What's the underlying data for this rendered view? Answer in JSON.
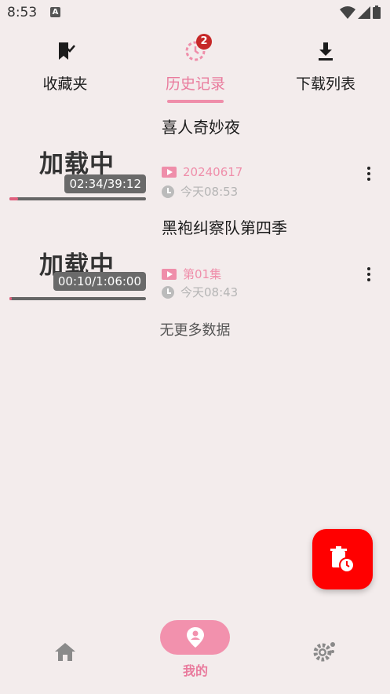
{
  "status_bar": {
    "time": "8:53",
    "notification_letter": "A"
  },
  "top_tabs": [
    {
      "label": "收藏夹",
      "icon": "bookmark-check-icon"
    },
    {
      "label": "历史记录",
      "icon": "history-icon",
      "badge": "2",
      "active": true
    },
    {
      "label": "下载列表",
      "icon": "download-icon"
    }
  ],
  "history": [
    {
      "title": "喜人奇妙夜",
      "thumb_text": "加载中",
      "duration": "02:34/39:12",
      "progress": 0.065,
      "episode": "20240617",
      "watched": "今天08:53"
    },
    {
      "title": "黑袍纠察队第四季",
      "thumb_text": "加载中",
      "duration": "00:10/1:06:00",
      "progress": 0.003,
      "episode": "第01集",
      "watched": "今天08:43"
    }
  ],
  "no_more_text": "无更多数据",
  "fab": {
    "icon": "clear-history-icon"
  },
  "bottom_nav": [
    {
      "label": "",
      "icon": "home-icon"
    },
    {
      "label": "我的",
      "icon": "person-pin-icon",
      "active": true
    },
    {
      "label": "",
      "icon": "settings-icon"
    }
  ],
  "colors": {
    "accent": "#ef8eaa",
    "fab": "#ff0000",
    "badge": "#c62828",
    "background": "#f3ecec"
  }
}
